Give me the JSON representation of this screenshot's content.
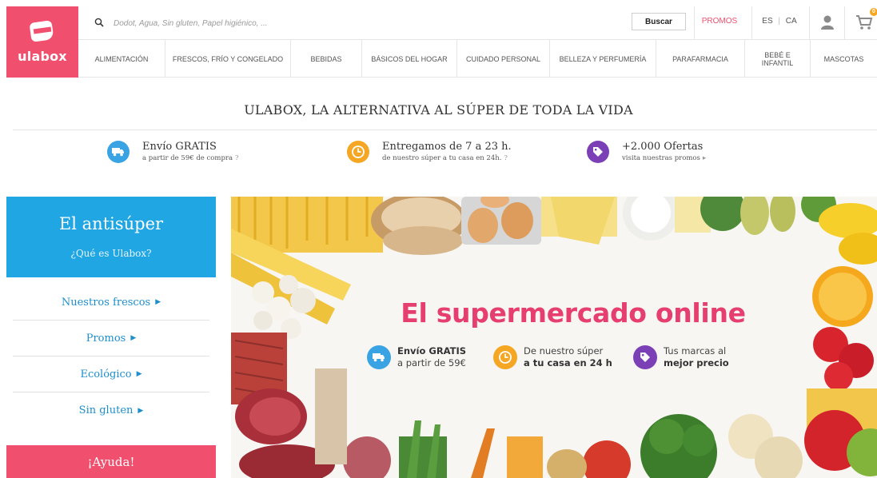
{
  "header": {
    "logo_text": "ulabox",
    "search_placeholder": "Dodot, Agua, Sin gluten, Papel higiénico, ...",
    "search_button": "Buscar",
    "promos_link": "PROMOS",
    "lang_es": "ES",
    "lang_sep": "|",
    "lang_ca": "CA",
    "cart_count": "0",
    "brand_color": "#f0506e"
  },
  "nav": {
    "items": [
      {
        "label": "ALIMENTACIÓN"
      },
      {
        "label": "FRESCOS, FRÍO Y CONGELADO"
      },
      {
        "label": "BEBIDAS"
      },
      {
        "label": "BÁSICOS DEL HOGAR"
      },
      {
        "label": "CUIDADO PERSONAL"
      },
      {
        "label": "BELLEZA Y PERFUMERÍA"
      },
      {
        "label": "PARAFARMACIA"
      },
      {
        "label": "BEBÉ E INFANTIL"
      },
      {
        "label": "MASCOTAS"
      }
    ]
  },
  "tagline": "ULABOX, LA ALTERNATIVA AL SÚPER DE TODA LA VIDA",
  "benefits": [
    {
      "icon": "truck-icon",
      "color": "#3aa3e3",
      "title": "Envío GRATIS",
      "subtitle": "a partir de 59€ de compra",
      "suffix": "?"
    },
    {
      "icon": "clock-icon",
      "color": "#f5a623",
      "title": "Entregamos de 7 a 23 h.",
      "subtitle": "de nuestro súper a tu casa en 24h.",
      "suffix": "?"
    },
    {
      "icon": "tag-icon",
      "color": "#7b3fb6",
      "title": "+2.000 Ofertas",
      "subtitle": "visita nuestras promos",
      "suffix": "▸"
    }
  ],
  "sidebar": {
    "title": "El antisúper",
    "subtitle": "¿Qué es Ulabox?",
    "links": [
      {
        "label": "Nuestros frescos"
      },
      {
        "label": "Promos"
      },
      {
        "label": "Ecológico"
      },
      {
        "label": "Sin gluten"
      }
    ],
    "help": "¡Ayuda!"
  },
  "banner": {
    "title": "El supermercado online",
    "features": [
      {
        "icon": "truck-icon",
        "color": "#3aa3e3",
        "line1": "Envío GRATIS",
        "line2": "a partir de 59€"
      },
      {
        "icon": "clock-icon",
        "color": "#f5a623",
        "line1": "De nuestro súper",
        "line2": "a tu casa en 24 h"
      },
      {
        "icon": "tag-icon",
        "color": "#7b3fb6",
        "line1": "Tus marcas al",
        "line2": "mejor precio"
      }
    ]
  }
}
